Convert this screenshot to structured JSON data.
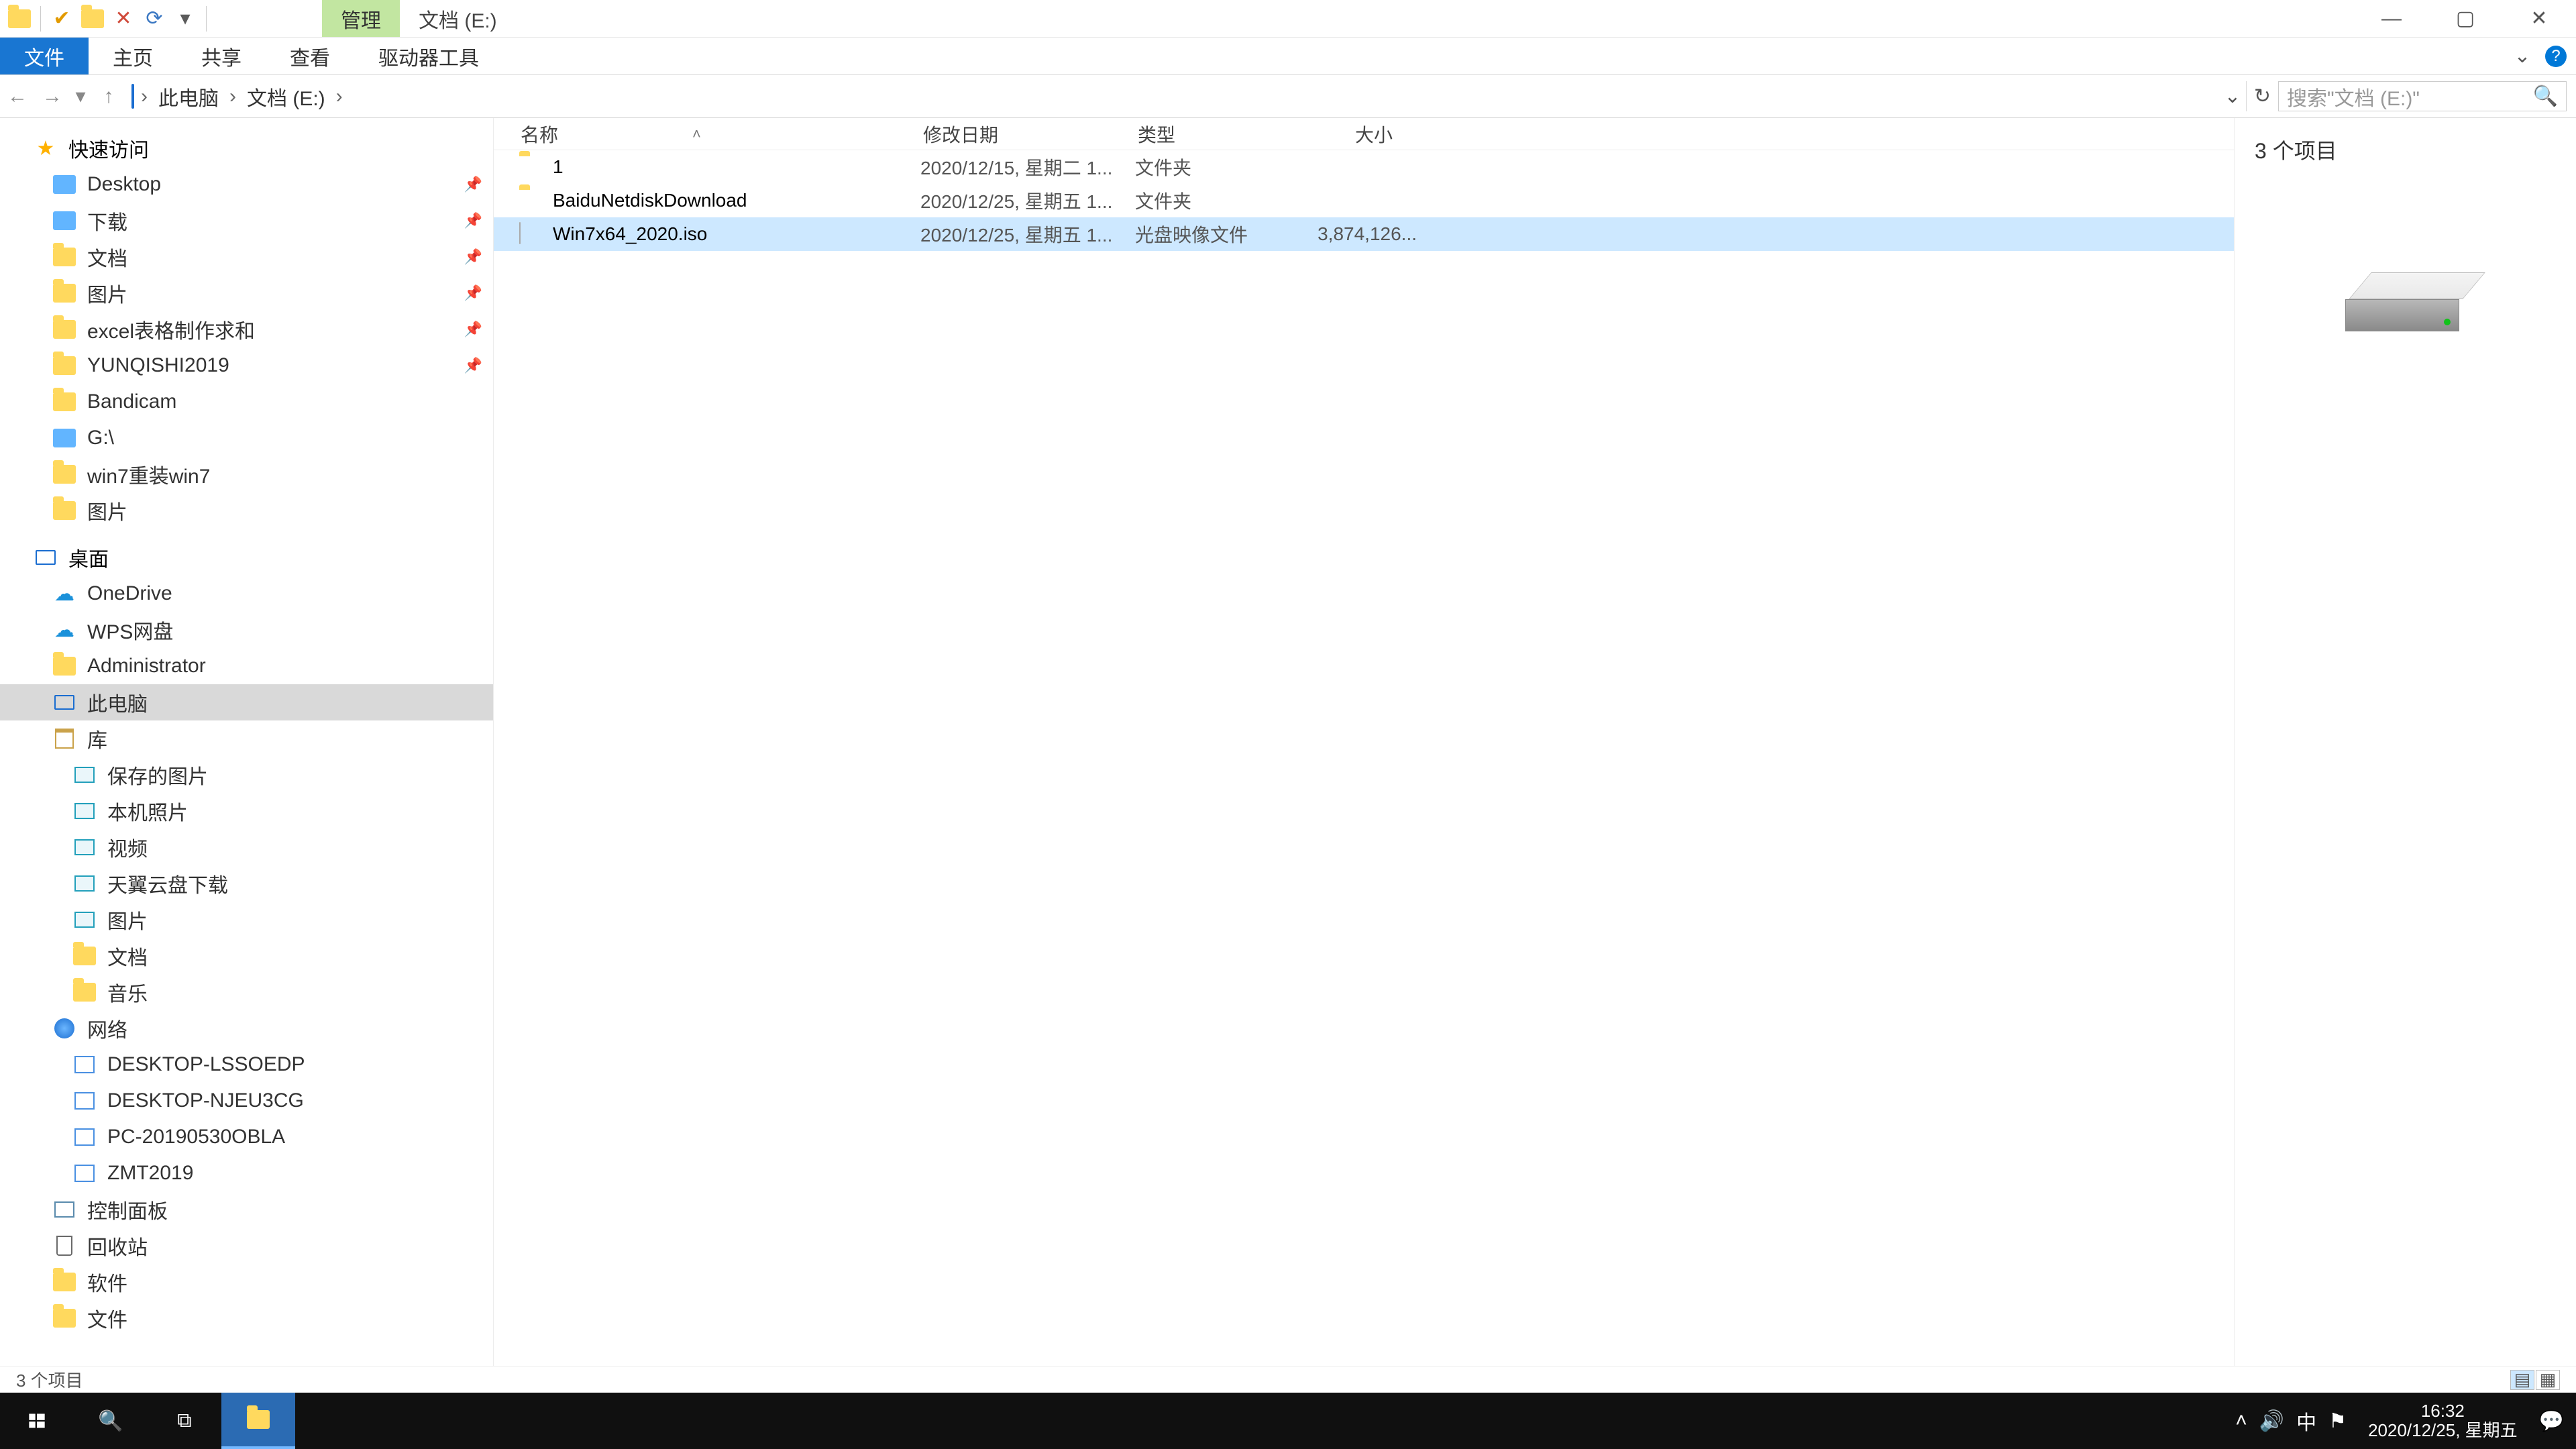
{
  "title": {
    "ribbon_context": "管理",
    "window_title": "文档 (E:)"
  },
  "ribbon": {
    "file": "文件",
    "home": "主页",
    "share": "共享",
    "view": "查看",
    "drive_tools": "驱动器工具"
  },
  "breadcrumb": {
    "seg1": "此电脑",
    "seg2": "文档 (E:)"
  },
  "search": {
    "placeholder": "搜索\"文档 (E:)\""
  },
  "navpane": {
    "quick_access": "快速访问",
    "quick_items": [
      {
        "label": "Desktop",
        "icon": "blue-folder",
        "pin": true
      },
      {
        "label": "下载",
        "icon": "blue-folder",
        "pin": true
      },
      {
        "label": "文档",
        "icon": "folder-ic",
        "pin": true
      },
      {
        "label": "图片",
        "icon": "folder-ic",
        "pin": true
      },
      {
        "label": "excel表格制作求和",
        "icon": "folder-ic",
        "pin": true
      },
      {
        "label": "YUNQISHI2019",
        "icon": "folder-ic",
        "pin": true
      },
      {
        "label": "Bandicam",
        "icon": "folder-ic",
        "pin": false
      },
      {
        "label": "G:\\",
        "icon": "blue-folder",
        "pin": false
      },
      {
        "label": "win7重装win7",
        "icon": "folder-ic",
        "pin": false
      },
      {
        "label": "图片",
        "icon": "folder-ic",
        "pin": false
      }
    ],
    "desktop": "桌面",
    "desktop_items": [
      {
        "label": "OneDrive",
        "icon": "cloud-ic"
      },
      {
        "label": "WPS网盘",
        "icon": "cloud-ic"
      },
      {
        "label": "Administrator",
        "icon": "folder-ic"
      },
      {
        "label": "此电脑",
        "icon": "blue-mon",
        "selected": true
      },
      {
        "label": "库",
        "icon": "lib-ic"
      }
    ],
    "lib_items": [
      {
        "label": "保存的图片",
        "icon": "pic-ic"
      },
      {
        "label": "本机照片",
        "icon": "pic-ic"
      },
      {
        "label": "视频",
        "icon": "pic-ic"
      },
      {
        "label": "天翼云盘下载",
        "icon": "pic-ic"
      },
      {
        "label": "图片",
        "icon": "pic-ic"
      },
      {
        "label": "文档",
        "icon": "folder-ic"
      },
      {
        "label": "音乐",
        "icon": "folder-ic"
      }
    ],
    "network": "网络",
    "net_items": [
      {
        "label": "DESKTOP-LSSOEDP",
        "icon": "pc-ic"
      },
      {
        "label": "DESKTOP-NJEU3CG",
        "icon": "pc-ic"
      },
      {
        "label": "PC-20190530OBLA",
        "icon": "pc-ic"
      },
      {
        "label": "ZMT2019",
        "icon": "pc-ic"
      }
    ],
    "ctrl": "控制面板",
    "bin": "回收站",
    "soft": "软件",
    "docs": "文件"
  },
  "columns": {
    "name": "名称",
    "date": "修改日期",
    "type": "类型",
    "size": "大小"
  },
  "rows": [
    {
      "name": "1",
      "date": "2020/12/15, 星期二 1...",
      "type": "文件夹",
      "size": "",
      "icon": "folder-ic",
      "selected": false
    },
    {
      "name": "BaiduNetdiskDownload",
      "date": "2020/12/25, 星期五 1...",
      "type": "文件夹",
      "size": "",
      "icon": "folder-ic",
      "selected": false
    },
    {
      "name": "Win7x64_2020.iso",
      "date": "2020/12/25, 星期五 1...",
      "type": "光盘映像文件",
      "size": "3,874,126...",
      "icon": "file-ic",
      "selected": true
    }
  ],
  "preview": {
    "count_label": "3 个项目"
  },
  "status": {
    "text": "3 个项目"
  },
  "taskbar": {
    "time": "16:32",
    "date": "2020/12/25, 星期五",
    "ime": "中"
  }
}
